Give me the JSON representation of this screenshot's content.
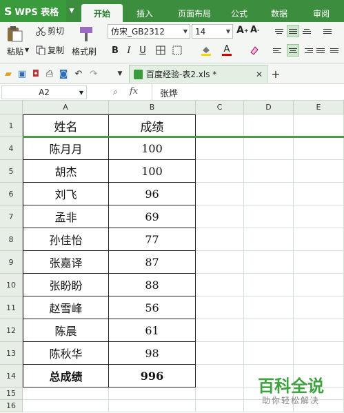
{
  "app": {
    "name": "WPS 表格"
  },
  "tabs": [
    "开始",
    "插入",
    "页面布局",
    "公式",
    "数据",
    "审阅"
  ],
  "active_tab": "开始",
  "ribbon": {
    "paste": "粘贴",
    "cut": "剪切",
    "copy": "复制",
    "format_painter": "格式刷",
    "font_name": "仿宋_GB2312",
    "font_size": "14",
    "font_color": "#d40000",
    "fill_color": "#f5d600"
  },
  "document": {
    "tab_title": "百度经验-表2.xls *"
  },
  "formula_bar": {
    "cell_ref": "A2",
    "fx": "fx",
    "value": "张烨"
  },
  "columns": [
    "A",
    "B",
    "C",
    "D",
    "E"
  ],
  "rows": [
    {
      "num": "1",
      "a": "姓名",
      "b": "成绩"
    },
    {
      "num": "4",
      "a": "陈月月",
      "b": "100"
    },
    {
      "num": "5",
      "a": "胡杰",
      "b": "100"
    },
    {
      "num": "6",
      "a": "刘飞",
      "b": "96"
    },
    {
      "num": "7",
      "a": "孟非",
      "b": "69"
    },
    {
      "num": "8",
      "a": "孙佳怡",
      "b": "77"
    },
    {
      "num": "9",
      "a": "张嘉译",
      "b": "87"
    },
    {
      "num": "10",
      "a": "张盼盼",
      "b": "88"
    },
    {
      "num": "11",
      "a": "赵雪峰",
      "b": "56"
    },
    {
      "num": "12",
      "a": "陈晨",
      "b": "61"
    },
    {
      "num": "13",
      "a": "陈秋华",
      "b": "98"
    },
    {
      "num": "14",
      "a": "总成绩",
      "b": "996"
    },
    {
      "num": "15",
      "a": "",
      "b": ""
    },
    {
      "num": "16",
      "a": "",
      "b": ""
    }
  ],
  "watermark": {
    "title": "百科全说",
    "subtitle": "助你轻松解决"
  }
}
